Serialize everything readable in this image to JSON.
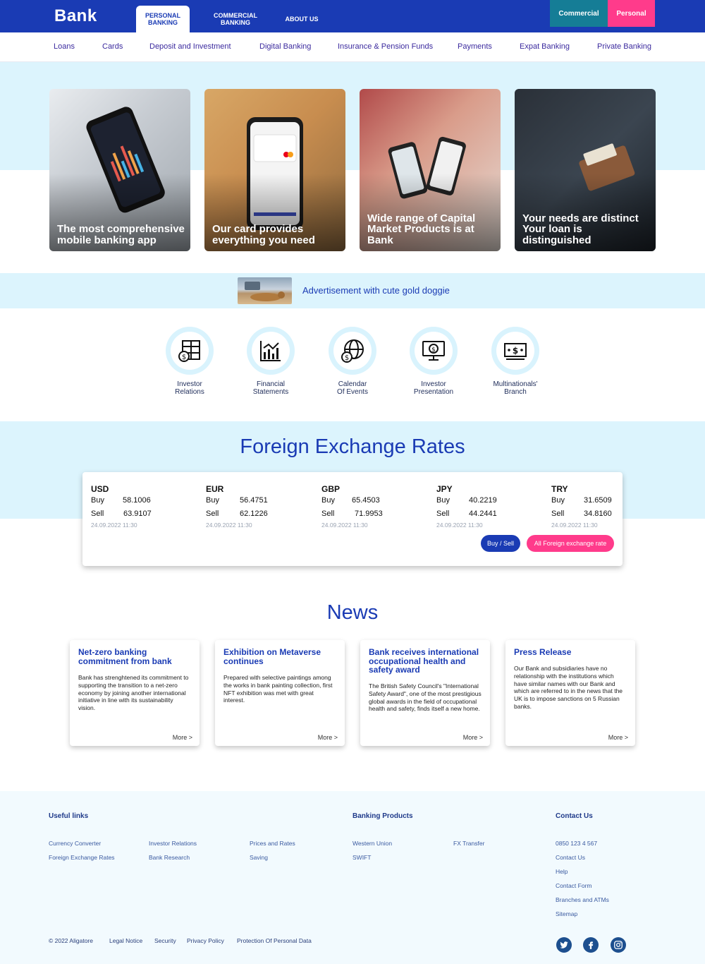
{
  "header": {
    "logo": "Bank",
    "tabs": [
      {
        "label": "PERSONAL BANKING"
      },
      {
        "label": "COMMERCIAL BANKING"
      },
      {
        "label": "ABOUT US"
      }
    ],
    "segment": {
      "commercial": "Commercial",
      "personal": "Personal"
    }
  },
  "subnav": [
    "Loans",
    "Cards",
    "Deposit and Investment",
    "Digital Banking",
    "Insurance & Pension Funds",
    "Payments",
    "Expat Banking",
    "Private Banking"
  ],
  "hero": {
    "cards": [
      {
        "caption": "The most comprehensive mobile banking app"
      },
      {
        "caption": "Our card provides everything you need"
      },
      {
        "caption": "Wide range of Capital Market Products is at Bank"
      },
      {
        "caption": "Your needs are distinct Your loan is distinguished"
      }
    ]
  },
  "ad": {
    "text": "Advertisement with cute gold doggie"
  },
  "quick_links": [
    {
      "label": "Investor\nRelations",
      "icon": "investor-relations-icon"
    },
    {
      "label": "Financial\nStatements",
      "icon": "financial-statements-icon"
    },
    {
      "label": "Calendar\nOf Events",
      "icon": "calendar-globe-icon"
    },
    {
      "label": "Investor\nPresentation",
      "icon": "presentation-monitor-icon"
    },
    {
      "label": "Multinationals'\nBranch",
      "icon": "banknote-icon"
    }
  ],
  "fx": {
    "title": "Foreign Exchange Rates",
    "buy_label": "Buy",
    "sell_label": "Sell",
    "currencies": [
      {
        "code": "USD",
        "buy": "58.1006",
        "sell": "63.9107",
        "time": "24.09.2022 11:30"
      },
      {
        "code": "EUR",
        "buy": "56.4751",
        "sell": "62.1226",
        "time": "24.09.2022 11:30"
      },
      {
        "code": "GBP",
        "buy": "65.4503",
        "sell": "71.9953",
        "time": "24.09.2022 11:30"
      },
      {
        "code": "JPY",
        "buy": "40.2219",
        "sell": "44.2441",
        "time": "24.09.2022 11:30"
      },
      {
        "code": "TRY",
        "buy": "31.6509",
        "sell": "34.8160",
        "time": "24.09.2022 11:30"
      }
    ],
    "buy_sell_button": "Buy / Sell",
    "all_button": "All Foreign exchange rate"
  },
  "news": {
    "title": "News",
    "more_label": "More >",
    "items": [
      {
        "title": "Net-zero banking commitment from bank",
        "body": "Bank has strenghtened its commitment to supporting the transition to a net-zero economy by joining another international initiative in line with its sustainability vision."
      },
      {
        "title": "Exhibition on Metaverse continues",
        "body": "Prepared with selective paintings among the works in bank painting collection, first NFT exhibition was met with great interest."
      },
      {
        "title": "Bank receives international occupational health and safety award",
        "body": "The British Safety Council's \"International Safety Award\", one of the most prestigious global awards in the field of occupational health and safety, finds itself a new home."
      },
      {
        "title": "Press Release",
        "body": "Our Bank and subsidiaries have no relationship with the institutions which have similar names with our Bank and which are referred to in the news that the UK is to impose sanctions on 5 Russian banks."
      }
    ]
  },
  "footer": {
    "useful_links": {
      "heading": "Useful links",
      "col1": [
        "Currency Converter",
        "Foreign Exchange Rates"
      ],
      "col2": [
        "Investor Relations",
        "Bank Research"
      ],
      "col3": [
        "Prices and Rates",
        "Saving"
      ]
    },
    "banking_products": {
      "heading": "Banking Products",
      "col1": [
        "Western Union",
        "SWIFT"
      ],
      "col2": [
        "FX Transfer"
      ]
    },
    "contact": {
      "heading": "Contact Us",
      "items": [
        "0850 123 4 567",
        "Contact Us",
        "Help",
        "Contact Form",
        "Branches and ATMs",
        "Sitemap"
      ]
    },
    "copyright": "© 2022 Aligatore",
    "legal": [
      "Legal Notice",
      "Security",
      "Privacy Policy",
      "Protection Of Personal Data"
    ],
    "social": [
      "twitter-icon",
      "facebook-icon",
      "instagram-icon"
    ]
  },
  "colors": {
    "primary": "#1a3bb4",
    "accent": "#ff3b8b",
    "teal": "#157d96",
    "light_band": "#dcf4fd"
  }
}
